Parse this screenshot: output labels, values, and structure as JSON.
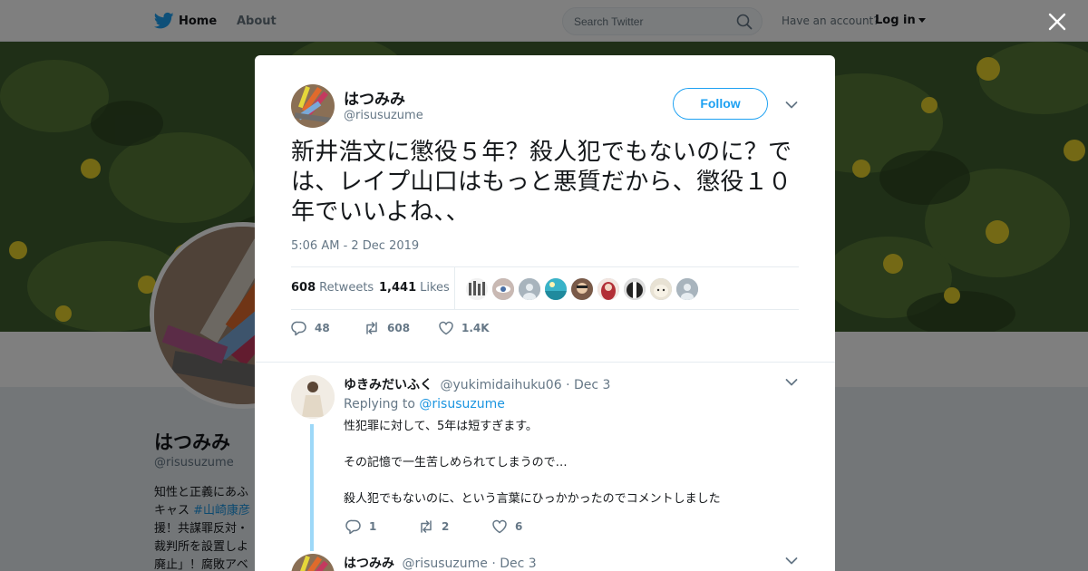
{
  "nav": {
    "home": "Home",
    "about": "About",
    "search_placeholder": "Search Twitter",
    "have_account": "Have an account?",
    "login": "Log in"
  },
  "profile": {
    "name": "はつみみ",
    "handle": "@risusuzume",
    "bio_lines": [
      "知性と正義にあふ",
      "キャス ",
      "援！共謀罪反対・",
      "裁判所を設置しよ",
      "廃止」！腐敗アベ"
    ],
    "bio_tag": "#山崎康彦"
  },
  "tweet": {
    "author_name": "はつみみ",
    "author_handle": "@risusuzume",
    "follow_label": "Follow",
    "text": "新井浩文に懲役５年？殺人犯でもないのに？では、レイプ山口はもっと悪質だから、懲役１０年でいいよね、、",
    "timestamp": "5:06 AM - 2 Dec 2019",
    "retweets_count": "608",
    "retweets_label": "Retweets",
    "likes_count": "1,441",
    "likes_label": "Likes",
    "actions": {
      "replies": "48",
      "retweets": "608",
      "likes": "1.4K"
    }
  },
  "replies": [
    {
      "name": "ゆきみだいふく",
      "handle": "@yukimidaihuku06",
      "date": "· Dec 3",
      "replying_prefix": "Replying to",
      "replying_to": "@risusuzume",
      "paragraphs": [
        "性犯罪に対して、5年は短すぎます。",
        "その記憶で一生苦しめられてしまうので…",
        "殺人犯でもないのに、という言葉にひっかかったのでコメントしました"
      ],
      "actions": {
        "replies": "1",
        "retweets": "2",
        "likes": "6"
      }
    },
    {
      "name": "はつみみ",
      "handle": "@risusuzume",
      "date": "· Dec 3"
    }
  ],
  "colors": {
    "twitter_blue": "#1da1f2",
    "link_blue": "#1b95e0",
    "muted_gray": "#657786",
    "thread_line": "#9dd8f8"
  },
  "icons": {
    "logo": "twitter-bird-icon",
    "search": "magnifier-icon",
    "close": "x-close-icon",
    "more": "chevron-down-icon",
    "reply": "speech-bubble-icon",
    "retweet": "retweet-arrows-icon",
    "like": "heart-icon"
  }
}
